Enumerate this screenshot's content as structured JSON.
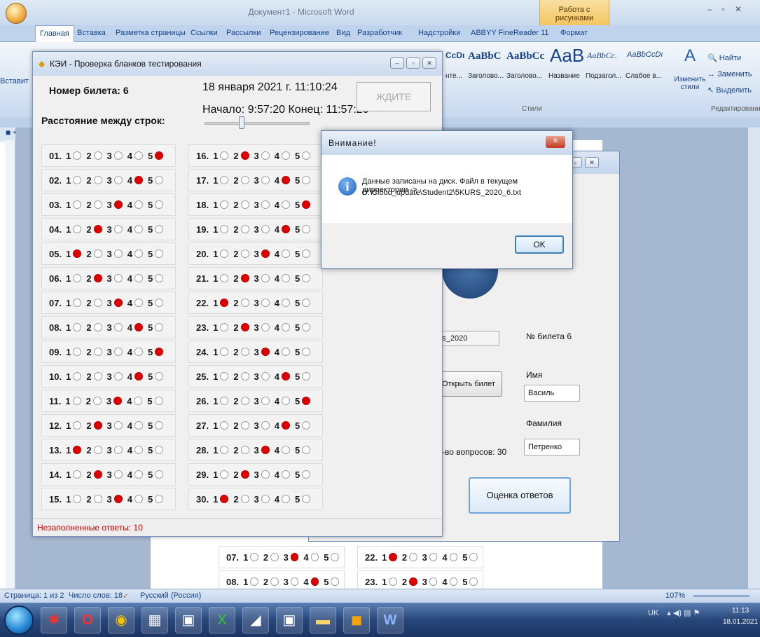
{
  "word": {
    "title": "Документ1 - Microsoft Word",
    "context_group": "Работа с рисунками",
    "tabs": [
      "Главная",
      "Вставка",
      "Разметка страницы",
      "Ссылки",
      "Рассылки",
      "Рецензирование",
      "Вид",
      "Разработчик",
      "Надстройки",
      "ABBYY FineReader 11",
      "Формат"
    ],
    "insert_label": "Вставит",
    "styles": [
      {
        "preview": "AaBbC",
        "name": "Заголово..."
      },
      {
        "preview": "AaBbCc",
        "name": "Заголово..."
      },
      {
        "preview": "AaB",
        "name": "Название"
      },
      {
        "preview": "AaBbCc.",
        "name": "Подзагол..."
      },
      {
        "preview": "AaBbCcDı",
        "name": "Слабое в..."
      }
    ],
    "style_partial_preview": "CcDı",
    "style_partial_name": "нте...",
    "styles_group_label": "Стили",
    "change_styles_label": "Изменить стили",
    "edit": {
      "find": "Найти",
      "replace": "Заменить",
      "select": "Выделить",
      "group_label": "Редактирование"
    },
    "status": {
      "page": "Страница: 1 из 2",
      "words": "Число слов: 18",
      "language": "Русский (Россия)",
      "zoom": "107%"
    }
  },
  "taskbar": {
    "lang": "UK",
    "time": "11:13",
    "date": "18.01.2021"
  },
  "main_dialog": {
    "title": "КЭИ - Проверка бланков тестирования",
    "ticket_label": "Номер билета: 6",
    "spacing_label": "Расстояние между строк:",
    "datetime": "18 января 2021 г. 11:10:24",
    "timespan": "Начало: 9:57:20  Конец: 11:57:20",
    "wait_button": "ЖДИТЕ",
    "status_text": "Незаполненные ответы: 10",
    "slider_level": 0.35,
    "answers": [
      {
        "n": "01.",
        "sel": 5
      },
      {
        "n": "02.",
        "sel": 4
      },
      {
        "n": "03.",
        "sel": 3
      },
      {
        "n": "04.",
        "sel": 2
      },
      {
        "n": "05.",
        "sel": 1
      },
      {
        "n": "06.",
        "sel": 2
      },
      {
        "n": "07.",
        "sel": 3
      },
      {
        "n": "08.",
        "sel": 4
      },
      {
        "n": "09.",
        "sel": 5
      },
      {
        "n": "10.",
        "sel": 4
      },
      {
        "n": "11.",
        "sel": 3
      },
      {
        "n": "12.",
        "sel": 2
      },
      {
        "n": "13.",
        "sel": 1
      },
      {
        "n": "14.",
        "sel": 2
      },
      {
        "n": "15.",
        "sel": 3
      },
      {
        "n": "16.",
        "sel": 2
      },
      {
        "n": "17.",
        "sel": 4
      },
      {
        "n": "18.",
        "sel": 5
      },
      {
        "n": "19.",
        "sel": 4
      },
      {
        "n": "20.",
        "sel": 3
      },
      {
        "n": "21.",
        "sel": 2
      },
      {
        "n": "22.",
        "sel": 1
      },
      {
        "n": "23.",
        "sel": 2
      },
      {
        "n": "24.",
        "sel": 3
      },
      {
        "n": "25.",
        "sel": 4
      },
      {
        "n": "26.",
        "sel": 5
      },
      {
        "n": "27.",
        "sel": 4
      },
      {
        "n": "28.",
        "sel": 3
      },
      {
        "n": "29.",
        "sel": 2
      },
      {
        "n": "30.",
        "sel": 1
      }
    ]
  },
  "second_window": {
    "file_field": "kurs_2020",
    "ticket_no": "№ билета 6",
    "open_ticket_button": "Открыть билет",
    "name_label": "Имя",
    "name_value": "Василь",
    "surname_label": "Фамилия",
    "surname_value": "Петренко",
    "question_count": "-во вопросов: 30",
    "grade_button": "Оценка ответов"
  },
  "doc_rows": [
    {
      "n": "07.",
      "sel": 3
    },
    {
      "n": "22.",
      "sel": 1
    },
    {
      "n": "08.",
      "sel": 4
    },
    {
      "n": "23.",
      "sel": 2
    }
  ],
  "alert": {
    "title": "Внимание!",
    "message_line1": "Данные записаны на диск. Файл в текущем дирректории ->",
    "message_line2": "D:\\Cloud_update\\Student2\\5KURS_2020_6.txt",
    "ok": "OK"
  }
}
